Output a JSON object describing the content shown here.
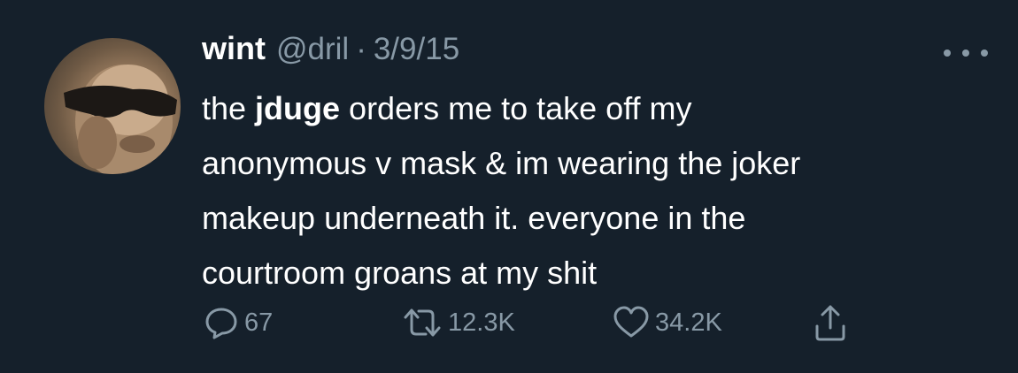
{
  "tweet": {
    "author": {
      "name": "wint",
      "handle": "@dril",
      "separator": "·",
      "date": "3/9/15"
    },
    "text": {
      "line1_before": "the ",
      "line1_bold": "jduge",
      "line1_after": " orders me to take off my",
      "line2": "anonymous v mask & im wearing the joker",
      "line3": "makeup underneath it. everyone in the",
      "line4": "courtroom groans at my shit"
    },
    "actions": {
      "replies": "67",
      "retweets": "12.3K",
      "likes": "34.2K"
    }
  },
  "icons": {
    "more": "more-horizontal-icon",
    "reply": "reply-icon",
    "retweet": "retweet-icon",
    "like": "heart-icon",
    "share": "share-icon"
  },
  "colors": {
    "background": "#15202b",
    "text": "#ffffff",
    "secondary": "#8899a6"
  }
}
